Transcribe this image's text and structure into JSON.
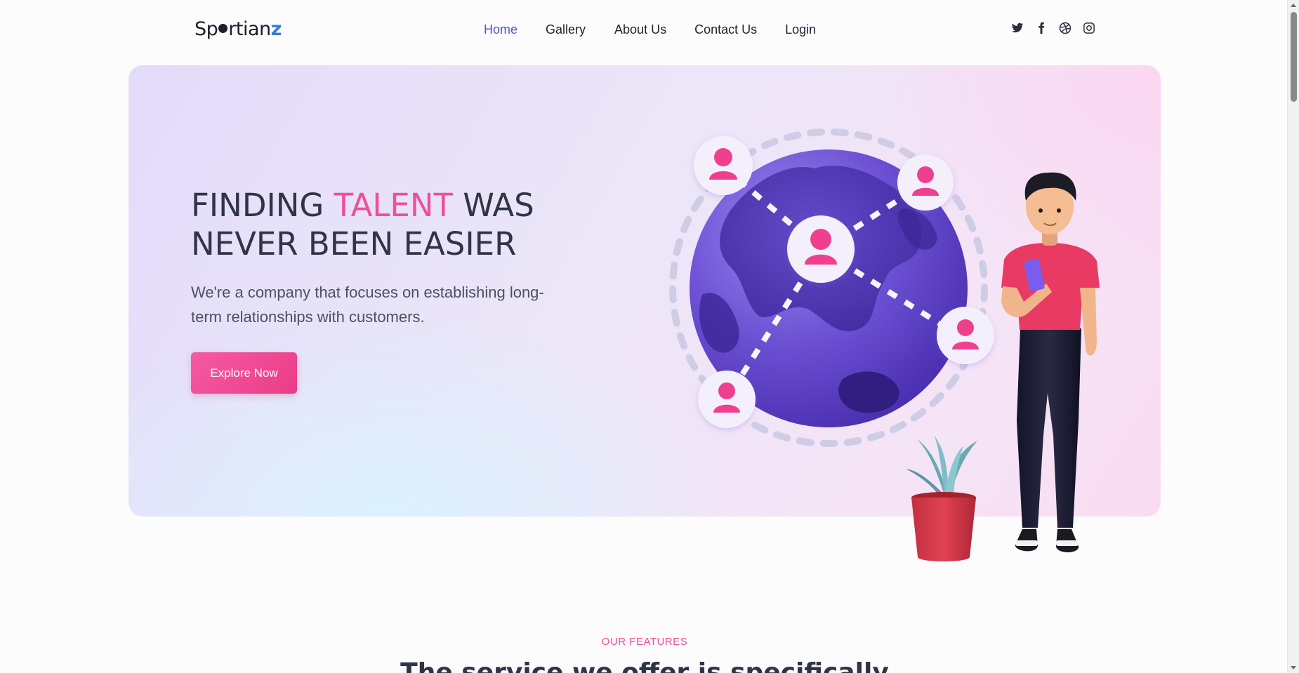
{
  "header": {
    "logo": {
      "text_head": "Sp",
      "text_mid": "rtian",
      "text_tail": "z"
    },
    "nav": [
      {
        "label": "Home",
        "active": true
      },
      {
        "label": "Gallery",
        "active": false
      },
      {
        "label": "About Us",
        "active": false
      },
      {
        "label": "Contact Us",
        "active": false
      },
      {
        "label": "Login",
        "active": false
      }
    ],
    "social": [
      "twitter-icon",
      "facebook-icon",
      "dribbble-icon",
      "instagram-icon"
    ]
  },
  "hero": {
    "title_part1": "FINDING ",
    "title_accent": "TALENT",
    "title_part2": " WAS NEVER BEEN EASIER",
    "subtitle": "We're a company that focuses on establishing long-term relationships with customers.",
    "cta_label": "Explore Now"
  },
  "features": {
    "eyebrow": "OUR FEATURES",
    "heading": "The service we offer is specifically"
  },
  "colors": {
    "accent_pink": "#ef4f9a",
    "nav_active": "#4a5bb8",
    "globe_purple": "#6a4fd2",
    "text_dark": "#2f3446"
  }
}
